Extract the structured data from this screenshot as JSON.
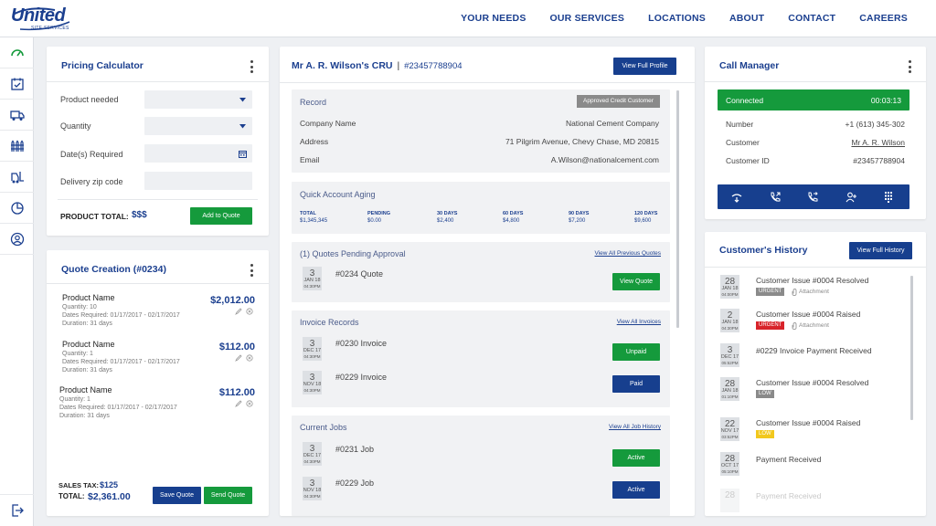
{
  "logo": {
    "word": "United",
    "sub": "SITE SERVICES"
  },
  "nav": [
    "YOUR NEEDS",
    "OUR SERVICES",
    "LOCATIONS",
    "ABOUT",
    "CONTACT",
    "CAREERS"
  ],
  "pricing": {
    "title": "Pricing Calculator",
    "fields": [
      {
        "label": "Product needed",
        "value": ""
      },
      {
        "label": "Quantity",
        "value": ""
      },
      {
        "label": "Date(s) Required",
        "value": ""
      },
      {
        "label": "Delivery zip code",
        "value": ""
      }
    ],
    "total_label": "PRODUCT TOTAL:",
    "total_value": "$$$",
    "add_button": "Add to Quote"
  },
  "quote": {
    "title": "Quote Creation (#0234)",
    "items": [
      {
        "name": "Product Name",
        "price": "$2,012.00",
        "qty": "Quantity: 10",
        "dates": "Dates Required: 01/17/2017 - 02/17/2017",
        "duration": "Duration: 31 days"
      },
      {
        "name": "Product Name",
        "price": "$112.00",
        "qty": "Quantity: 1",
        "dates": "Dates Required: 01/17/2017 - 02/17/2017",
        "duration": "Duration: 31 days"
      },
      {
        "name": "Product Name",
        "price": "$112.00",
        "qty": "Quantity: 1",
        "dates": "Dates Required: 01/17/2017 - 02/17/2017",
        "duration": "Duration: 31 days"
      }
    ],
    "sales_tax_label": "SALES TAX:",
    "sales_tax": "$125",
    "total_label": "TOTAL:",
    "total": "$2,361.00",
    "save_button": "Save Quote",
    "send_button": "Send Quote"
  },
  "cru": {
    "title": "Mr A. R. Wilson's CRU",
    "sep": "|",
    "number": "#23457788904",
    "profile_button": "View Full Profile",
    "record": {
      "title": "Record",
      "badge": "Approved Credit Customer",
      "rows": [
        {
          "k": "Company Name",
          "v": "National Cement Company"
        },
        {
          "k": "Address",
          "v": "71 Pilgrim Avenue, Chevy Chase, MD 20815"
        },
        {
          "k": "Email",
          "v": "A.Wilson@nationalcement.com"
        }
      ]
    },
    "aging": {
      "title": "Quick Account Aging",
      "cols": [
        {
          "h": "TOTAL",
          "v": "$1,345,345"
        },
        {
          "h": "PENDING",
          "v": "$0.00"
        },
        {
          "h": "30 DAYS",
          "v": "$2,400"
        },
        {
          "h": "60 DAYS",
          "v": "$4,800"
        },
        {
          "h": "90 DAYS",
          "v": "$7,200"
        },
        {
          "h": "120 DAYS",
          "v": "$9,600"
        }
      ]
    },
    "quotes": {
      "title": "(1) Quotes Pending Approval",
      "link": "View All Previous Quotes",
      "rows": [
        {
          "day": "3",
          "mon": "JAN 18",
          "time": "04:30PM",
          "label": "#0234 Quote",
          "button": "View Quote"
        }
      ]
    },
    "invoices": {
      "title": "Invoice Records",
      "link": "View All Invoices",
      "rows": [
        {
          "day": "3",
          "mon": "DEC 17",
          "time": "04:30PM",
          "label": "#0230 Invoice",
          "button": "Unpaid"
        },
        {
          "day": "3",
          "mon": "NOV 18",
          "time": "04:30PM",
          "label": "#0229 Invoice",
          "button": "Paid"
        }
      ]
    },
    "jobs": {
      "title": "Current Jobs",
      "link": "View All Job History",
      "rows": [
        {
          "day": "3",
          "mon": "DEC 17",
          "time": "04:30PM",
          "label": "#0231 Job",
          "button": "Active"
        },
        {
          "day": "3",
          "mon": "NOV 18",
          "time": "04:30PM",
          "label": "#0229 Job",
          "button": "Active"
        }
      ]
    }
  },
  "call": {
    "title": "Call Manager",
    "status": "Connected",
    "timer": "00:03:13",
    "rows": [
      {
        "k": "Number",
        "v": "+1 (613) 345-302"
      },
      {
        "k": "Customer",
        "v": "Mr A. R. Wilson"
      },
      {
        "k": "Customer ID",
        "v": "#23457788904"
      }
    ]
  },
  "history": {
    "title": "Customer's History",
    "button": "View Full History",
    "items": [
      {
        "day": "28",
        "mon": "JAN 18",
        "time": "04:00PM",
        "text": "Customer Issue #0004 Resolved",
        "badge": "URGENT",
        "badge_color": "#8a8a8a",
        "attach": "Attachment"
      },
      {
        "day": "2",
        "mon": "JAN 18",
        "time": "04:30PM",
        "text": "Customer Issue #0004 Raised",
        "badge": "URGENT",
        "badge_color": "#d8232a",
        "attach": "Attachment"
      },
      {
        "day": "3",
        "mon": "DEC 17",
        "time": "05:52PM",
        "text": "#0229 Invoice Payment Received",
        "badge": "",
        "badge_color": "",
        "attach": ""
      },
      {
        "day": "28",
        "mon": "JAN 18",
        "time": "01:10PM",
        "text": "Customer Issue #0004 Resolved",
        "badge": "LOW",
        "badge_color": "#8a8a8a",
        "attach": ""
      },
      {
        "day": "22",
        "mon": "NOV 17",
        "time": "03:52PM",
        "text": "Customer Issue #0004 Raised",
        "badge": "LOW",
        "badge_color": "#f2c81d",
        "attach": ""
      },
      {
        "day": "28",
        "mon": "OCT 17",
        "time": "05:10PM",
        "text": "Payment Received",
        "badge": "",
        "badge_color": "",
        "attach": ""
      },
      {
        "day": "28",
        "mon": "",
        "time": "",
        "text": "Payment Received",
        "badge": "",
        "badge_color": "",
        "attach": ""
      }
    ]
  },
  "colors": {
    "brand": "#1b3f8f",
    "green": "#159a3c",
    "urgent": "#d8232a",
    "low": "#f2c81d"
  }
}
